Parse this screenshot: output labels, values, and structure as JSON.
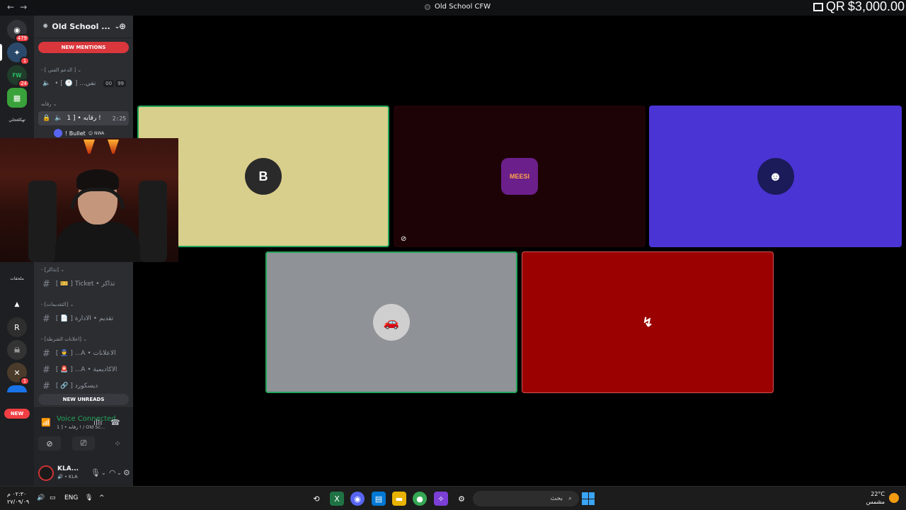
{
  "window": {
    "title": "Old School CFW",
    "nav_back": "←",
    "nav_fwd": "→"
  },
  "overlay": {
    "qr_text": "QR",
    "money": "$3,000.00"
  },
  "rail": {
    "items": [
      {
        "name": "dm-home",
        "glyph": "◉",
        "badge": "479",
        "bg": "#313338"
      },
      {
        "name": "server-1",
        "glyph": "✦",
        "badge": "1",
        "bg": "#2b4a6b"
      },
      {
        "name": "server-2",
        "glyph": "FW",
        "badge": "24",
        "bg": "#1f3d2a"
      },
      {
        "name": "server-3",
        "glyph": "▦",
        "badge": "",
        "bg": "#3aa23a"
      }
    ],
    "label_1": "تهكلعجلي",
    "label_2": "ملحقات",
    "new_label": "NEW"
  },
  "server": {
    "name": "Old School ...",
    "chevron": "⌄",
    "invite_icon": "👤+"
  },
  "sidebar": {
    "new_mentions": "NEW MENTIONS",
    "cat_support": "- [ الدعم الفني ] ⌄",
    "support_channel": {
      "icon": "🔈",
      "label": "• [ 🕐 ] ...نفي",
      "c1": "00",
      "c2": "99"
    },
    "cat_control": "رقابه ⌄",
    "control_channel": {
      "lock": "🔒",
      "icon": "🔈",
      "label": "رقابه • [ 1 !",
      "timer": "2:25"
    },
    "member": {
      "name": "! Bullet",
      "tag": "😊 NWA"
    },
    "cat_tickets": "- [تذاكر] ⌄",
    "ticket_channel": "[ 🎫 ] Ticket • تذاكر",
    "cat_submissions": "- [التقديمات] ⌄",
    "submit_channel": "[ 📄 ] تقديم • الادارة",
    "cat_police": "- [اعلانات الشرطة] ⌄",
    "ads_channel": "[ 👮 ] ...A • الاعلانات",
    "academy_channel": "[ 🚨 ] ...A • الاكاديمية",
    "discord_channel": "[ 🔗 ] ديسكورد",
    "new_unreads": "NEW UNREADS"
  },
  "voice": {
    "title": "Voice Connected",
    "subtitle": "رقابه • [ 1 ! / Old Sc...",
    "user_name": "KLA...",
    "user_status": "🔊 • KLA"
  },
  "tiles": [
    {
      "name": "tile-user-b",
      "bg": "#d9cf8c",
      "avatar_bg": "#2a2a2a",
      "glyph": "B",
      "speaking": true
    },
    {
      "name": "tile-user-meesi",
      "bg": "#1e0306",
      "avatar_bg": "#6b1f8a",
      "glyph": "MEESI",
      "speaking": false
    },
    {
      "name": "tile-user-3",
      "bg": "#4b34d4",
      "avatar_bg": "#1b1b5a",
      "glyph": "☻",
      "speaking": false
    },
    {
      "name": "tile-user-car",
      "bg": "#8f9296",
      "avatar_bg": "#cfcfcf",
      "glyph": "🚗",
      "speaking": true
    },
    {
      "name": "tile-user-red",
      "bg": "#9b0101",
      "avatar_bg": "#9b0101",
      "glyph": "↯",
      "speaking": false
    }
  ],
  "taskbar": {
    "time": "٠٢:٣٠ م",
    "date": "٢٧/٠٩/٠٩",
    "lang": "ENG",
    "search_placeholder": "بحث",
    "temp": "22°C",
    "weather": "مشمس"
  }
}
